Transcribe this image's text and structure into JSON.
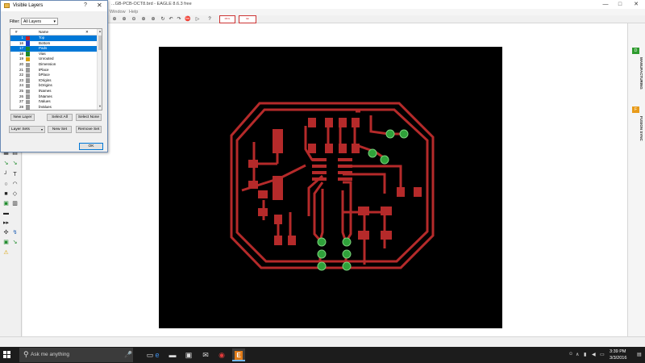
{
  "window": {
    "title": "...GB-PCB-OCT8.brd - EAGLE 8.6.3 free",
    "min": "—",
    "max": "□",
    "close": "✕"
  },
  "menu": {
    "window": "Window",
    "help": "Help"
  },
  "toolbar": {
    "box1": "MFG",
    "box2": "fab"
  },
  "right_panel": {
    "manufacturing_label": "MANUFACTURING",
    "manufacturing_badge": "D",
    "fusion_label": "FUSION SYNC",
    "fusion_badge": "F",
    "badge_colors": {
      "manufacturing": "#2e9b2e",
      "fusion": "#e89b1a"
    }
  },
  "dialog": {
    "title": "Visible Layers",
    "help_glyph": "?",
    "close_glyph": "✕",
    "filter_label": "Filter:",
    "filter_value": "All Layers",
    "column_num": "#",
    "column_name": "Name",
    "column_close": "✕",
    "layers": [
      {
        "num": "1",
        "name": "Top",
        "color": "#c91f1f",
        "selected": true
      },
      {
        "num": "16",
        "name": "Bottom",
        "color": "#1f3fc9",
        "selected": false
      },
      {
        "num": "17",
        "name": "Pads",
        "color": "#1d8a2a",
        "selected": true
      },
      {
        "num": "18",
        "name": "Vias",
        "color": "#1d8a2a",
        "selected": false
      },
      {
        "num": "19",
        "name": "Unrouted",
        "color": "#d9a000",
        "selected": false
      },
      {
        "num": "20",
        "name": "Dimension",
        "color": "#9a9a9a",
        "selected": false
      },
      {
        "num": "21",
        "name": "tPlace",
        "color": "#9a9a9a",
        "selected": false
      },
      {
        "num": "22",
        "name": "bPlace",
        "color": "#9a9a9a",
        "selected": false
      },
      {
        "num": "23",
        "name": "tOrigins",
        "color": "#9a9a9a",
        "selected": false
      },
      {
        "num": "24",
        "name": "bOrigins",
        "color": "#9a9a9a",
        "selected": false
      },
      {
        "num": "25",
        "name": "tNames",
        "color": "#9a9a9a",
        "selected": false
      },
      {
        "num": "26",
        "name": "bNames",
        "color": "#9a9a9a",
        "selected": false
      },
      {
        "num": "27",
        "name": "tValues",
        "color": "#9a9a9a",
        "selected": false
      },
      {
        "num": "28",
        "name": "bValues",
        "color": "#9a9a9a",
        "selected": false
      }
    ],
    "buttons": {
      "new_layer": "New Layer",
      "select_all": "Select All",
      "select_none": "Select None",
      "layer_sets": "Layer Sets",
      "new_set": "New Set",
      "remove_set": "Remove Set",
      "ok": "OK"
    }
  },
  "taskbar": {
    "search_placeholder": "Ask me anything",
    "time": "3:39 PM",
    "date": "3/3/2016"
  },
  "colors": {
    "copper": "#b52a2a",
    "pad": "#2fa23a",
    "board": "#000000",
    "selection": "#0078d7"
  }
}
